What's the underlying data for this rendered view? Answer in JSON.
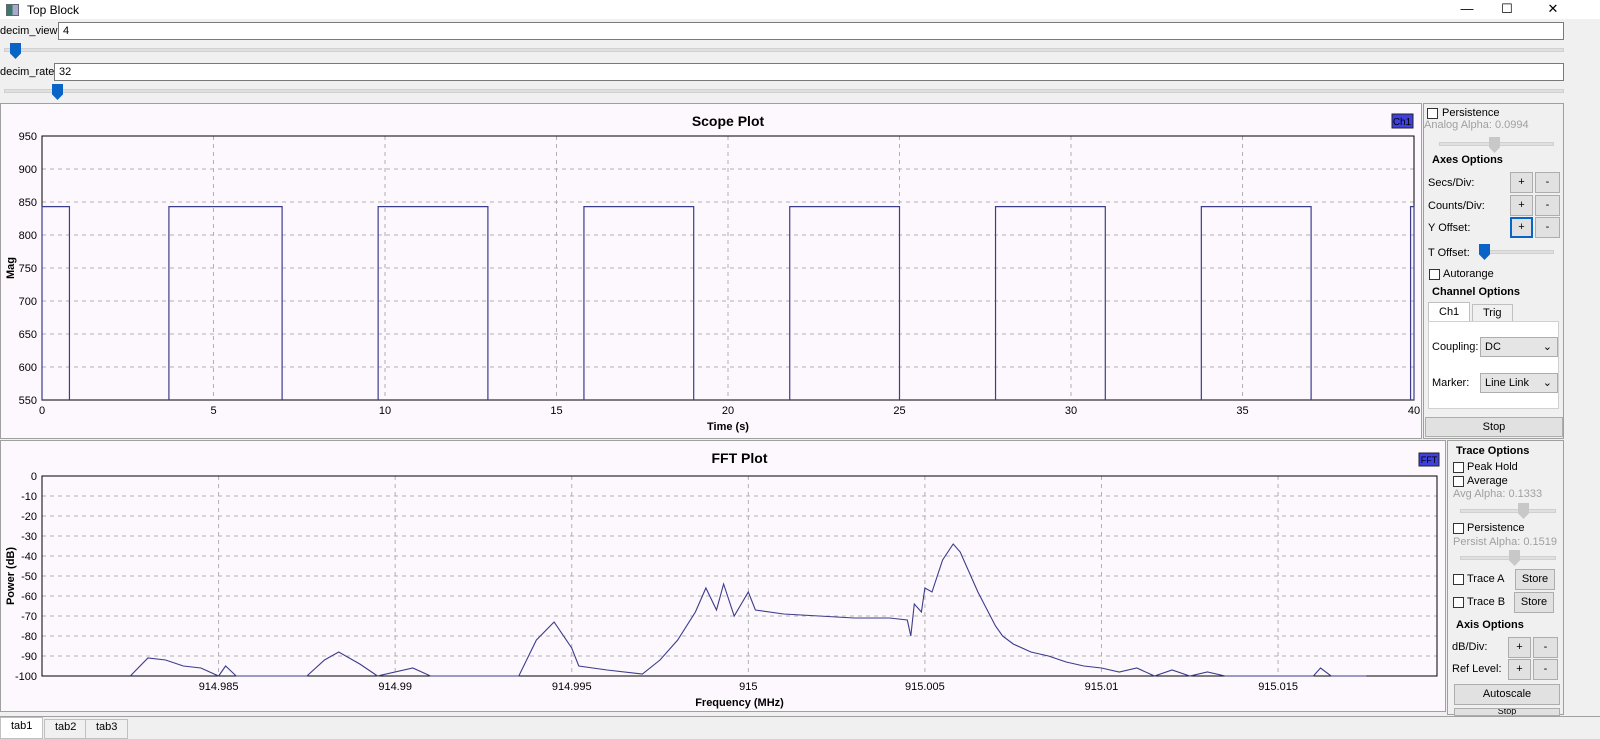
{
  "window": {
    "title": "Top Block",
    "minimize": "—",
    "maximize": "☐",
    "close": "✕"
  },
  "controls": {
    "decim_view": {
      "label": "decim_view:",
      "value": "4",
      "slider_fraction": 0.005
    },
    "decim_rate": {
      "label": "decim_rate:",
      "value": "32",
      "slider_fraction": 0.034
    }
  },
  "scope": {
    "side": {
      "persistence": "Persistence",
      "analog_alpha": "Analog Alpha: 0.0994",
      "analog_alpha_value": 0.0994,
      "axes_options": "Axes Options",
      "secs_div": "Secs/Div:",
      "counts_div": "Counts/Div:",
      "y_offset": "Y Offset:",
      "plus": "+",
      "minus": "-",
      "t_offset": "T Offset:",
      "autorange": "Autorange",
      "channel_options": "Channel Options",
      "tab_ch1": "Ch1",
      "tab_trig": "Trig",
      "coupling_label": "Coupling:",
      "coupling_value": "DC",
      "marker_label": "Marker:",
      "marker_value": "Line Link",
      "stop": "Stop"
    }
  },
  "fft": {
    "side": {
      "trace_options": "Trace Options",
      "peak_hold": "Peak Hold",
      "average": "Average",
      "avg_alpha": "Avg Alpha: 0.1333",
      "avg_alpha_value": 0.1333,
      "persistence": "Persistence",
      "persist_alpha": "Persist Alpha: 0.1519",
      "persist_alpha_value": 0.1519,
      "trace_a": "Trace A",
      "trace_b": "Trace B",
      "store": "Store",
      "axis_options": "Axis Options",
      "db_div": "dB/Div:",
      "ref_level": "Ref Level:",
      "plus": "+",
      "minus": "-",
      "autoscale": "Autoscale",
      "stop": "Stop"
    }
  },
  "tabs": [
    "tab1",
    "tab2",
    "tab3"
  ],
  "colors": {
    "trace": "#3c3c8c",
    "legend": "#4040e0"
  },
  "chart_data": [
    {
      "type": "line",
      "title": "Scope Plot",
      "xlabel": "Time (s)",
      "ylabel": "Mag",
      "xlim": [
        0,
        40
      ],
      "ylim": [
        550,
        950
      ],
      "xticks": [
        "0",
        "5",
        "10",
        "15",
        "20",
        "25",
        "30",
        "35",
        "40"
      ],
      "yticks": [
        "950",
        "900",
        "850",
        "800",
        "750",
        "700",
        "650",
        "600",
        "550"
      ],
      "legend": "Ch1",
      "legend_position": "top-right",
      "grid": true,
      "series": [
        {
          "name": "Ch1",
          "high": 843,
          "low": 540,
          "high_intervals": [
            [
              0,
              0.8
            ],
            [
              3.7,
              7.0
            ],
            [
              9.8,
              13.0
            ],
            [
              15.8,
              19.0
            ],
            [
              21.8,
              25.0
            ],
            [
              27.8,
              31.0
            ],
            [
              33.8,
              37.0
            ],
            [
              39.9,
              40
            ]
          ]
        }
      ]
    },
    {
      "type": "line",
      "title": "FFT Plot",
      "xlabel": "Frequency (MHz)",
      "ylabel": "Power (dB)",
      "xlim": [
        914.98,
        915.0195
      ],
      "ylim": [
        -100,
        0
      ],
      "xticks": [
        "914.985",
        "914.99",
        "914.995",
        "915",
        "915.005",
        "915.01",
        "915.015"
      ],
      "yticks": [
        "0",
        "-10",
        "-20",
        "-30",
        "-40",
        "-50",
        "-60",
        "-70",
        "-80",
        "-90",
        "-100"
      ],
      "legend": "FFT",
      "legend_position": "top-right",
      "grid": true,
      "series": [
        {
          "name": "FFT",
          "points": [
            [
              914.9825,
              -100
            ],
            [
              914.983,
              -91
            ],
            [
              914.9835,
              -92
            ],
            [
              914.984,
              -95
            ],
            [
              914.9845,
              -96
            ],
            [
              914.985,
              -100
            ],
            [
              914.9852,
              -95
            ],
            [
              914.9855,
              -100
            ],
            [
              914.9875,
              -100
            ],
            [
              914.988,
              -92
            ],
            [
              914.9884,
              -88
            ],
            [
              914.989,
              -94
            ],
            [
              914.9895,
              -100
            ],
            [
              914.9905,
              -96
            ],
            [
              914.991,
              -100
            ],
            [
              914.9935,
              -100
            ],
            [
              914.994,
              -82
            ],
            [
              914.9945,
              -73
            ],
            [
              914.995,
              -86
            ],
            [
              914.9952,
              -95
            ],
            [
              914.996,
              -97
            ],
            [
              914.997,
              -99
            ],
            [
              914.9975,
              -92
            ],
            [
              914.998,
              -82
            ],
            [
              914.9985,
              -68
            ],
            [
              914.9988,
              -56
            ],
            [
              914.9991,
              -67
            ],
            [
              914.9993,
              -54
            ],
            [
              914.9996,
              -70
            ],
            [
              915.0,
              -58
            ],
            [
              915.0002,
              -67
            ],
            [
              915.001,
              -69
            ],
            [
              915.002,
              -70
            ],
            [
              915.003,
              -71
            ],
            [
              915.004,
              -71
            ],
            [
              915.0045,
              -72
            ],
            [
              915.0046,
              -80
            ],
            [
              915.0047,
              -64
            ],
            [
              915.0049,
              -68
            ],
            [
              915.005,
              -56
            ],
            [
              915.0052,
              -58
            ],
            [
              915.0055,
              -42
            ],
            [
              915.0058,
              -34
            ],
            [
              915.006,
              -38
            ],
            [
              915.0065,
              -58
            ],
            [
              915.007,
              -75
            ],
            [
              915.0072,
              -80
            ],
            [
              915.0075,
              -84
            ],
            [
              915.008,
              -88
            ],
            [
              915.0085,
              -90
            ],
            [
              915.009,
              -93
            ],
            [
              915.0095,
              -95
            ],
            [
              915.01,
              -96
            ],
            [
              915.0105,
              -98
            ],
            [
              915.011,
              -96
            ],
            [
              915.0115,
              -100
            ],
            [
              915.012,
              -97
            ],
            [
              915.0125,
              -100
            ],
            [
              915.013,
              -98
            ],
            [
              915.0135,
              -100
            ],
            [
              915.016,
              -100
            ],
            [
              915.0162,
              -96
            ],
            [
              915.0165,
              -100
            ],
            [
              915.0175,
              -100
            ]
          ]
        }
      ]
    }
  ]
}
